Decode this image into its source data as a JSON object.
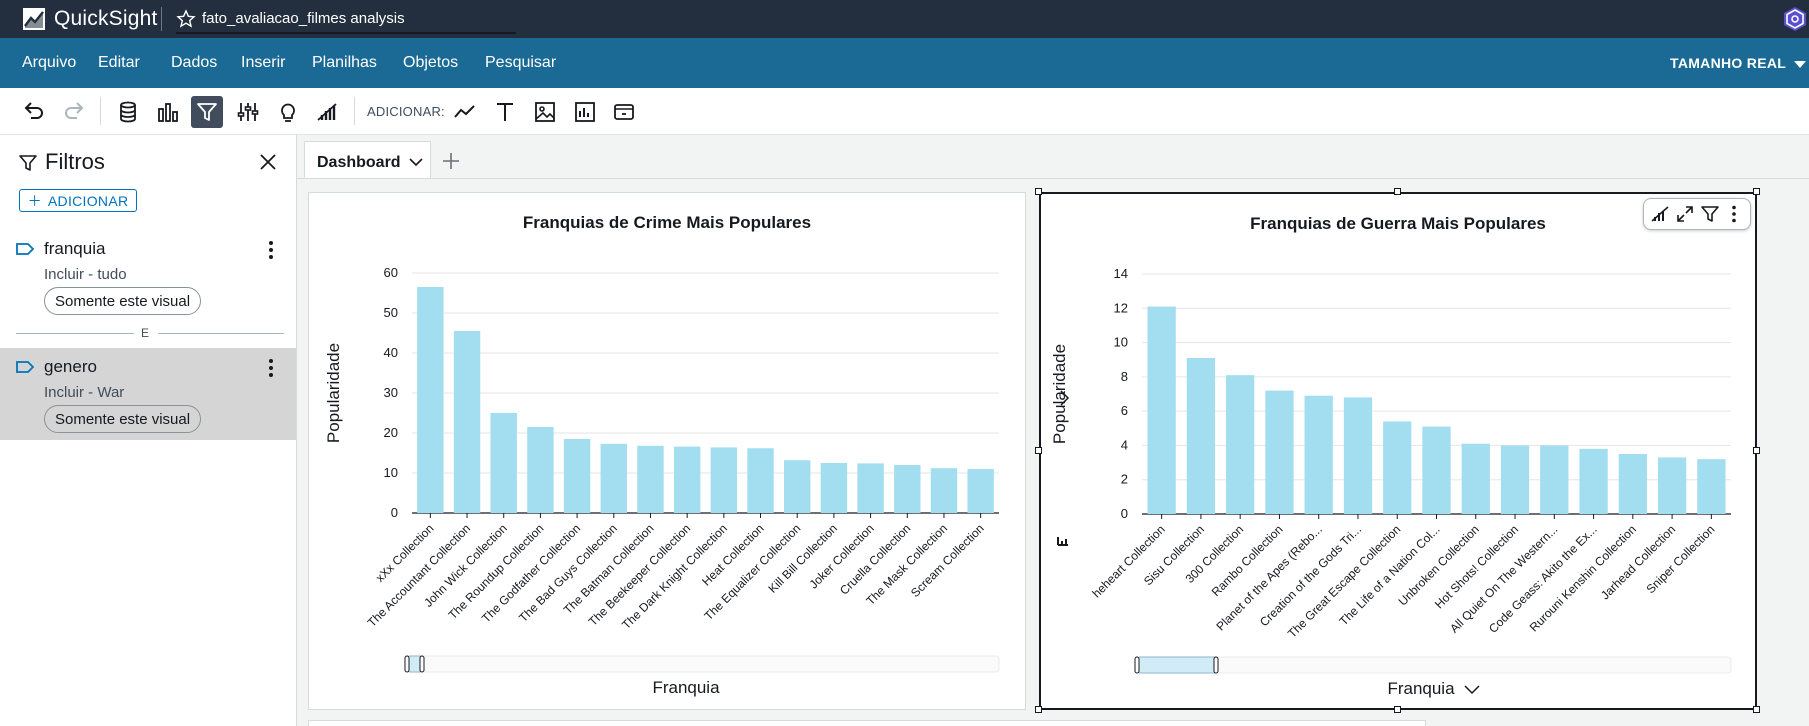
{
  "app": {
    "name": "QuickSight",
    "analysis_title": "fato_avaliacao_filmes analysis"
  },
  "menu": {
    "items": [
      "Arquivo",
      "Editar",
      "Dados",
      "Inserir",
      "Planilhas",
      "Objetos",
      "Pesquisar"
    ],
    "view_size": "TAMANHO REAL"
  },
  "toolbar": {
    "add_label": "ADICIONAR:",
    "icons": [
      "undo-icon",
      "redo-icon",
      "dataset-icon",
      "visualize-icon",
      "filter-icon",
      "parameters-icon",
      "insights-icon",
      "forecast-icon",
      "add-line-chart-icon",
      "add-text-icon",
      "add-image-icon",
      "add-insight-icon",
      "add-embed-icon"
    ]
  },
  "filters": {
    "title": "Filtros",
    "add_button": "ADICIONAR",
    "and_label": "E",
    "items": [
      {
        "field": "franquia",
        "condition": "Incluir - tudo",
        "scope": "Somente este visual",
        "selected": false
      },
      {
        "field": "genero",
        "condition": "Incluir - War",
        "scope": "Somente este visual",
        "selected": true
      }
    ]
  },
  "sheet": {
    "tab_label": "Dashboard"
  },
  "colors": {
    "bar": "#a3ddf0",
    "menubar": "#1a6a95",
    "topbar": "#232f3e",
    "accent": "#0073bb"
  },
  "chart_data": [
    {
      "type": "bar",
      "title": "Franquias de Crime Mais Populares",
      "xlabel": "Franquia",
      "ylabel": "Popularidade",
      "ylim": [
        0,
        60
      ],
      "yticks": [
        0,
        10,
        20,
        30,
        40,
        50,
        60
      ],
      "grid": true,
      "categories": [
        "xXx Collection",
        "The Accountant Collection",
        "John Wick Collection",
        "The Roundup Collection",
        "The Godfather Collection",
        "The Bad Guys Collection",
        "The Batman Collection",
        "The Beekeeper Collection",
        "The Dark Knight Collection",
        "Heat Collection",
        "The Equalizer Collection",
        "Kill Bill Collection",
        "Joker Collection",
        "Cruella Collection",
        "The Mask Collection",
        "Scream Collection"
      ],
      "values": [
        56.5,
        45.5,
        25,
        21.5,
        18.5,
        17.3,
        16.8,
        16.6,
        16.4,
        16.2,
        13.2,
        12.5,
        12.4,
        12,
        11.2,
        11
      ]
    },
    {
      "type": "bar",
      "title": "Franquias de Guerra Mais Populares",
      "xlabel": "Franquia",
      "ylabel": "Popularidade",
      "ylim": [
        0,
        14
      ],
      "yticks": [
        0,
        2,
        4,
        6,
        8,
        10,
        12,
        14
      ],
      "grid": true,
      "categories": [
        "heheart Collection",
        "Sisu Collection",
        "300 Collection",
        "Rambo Collection",
        "Planet of the Apes (Rebo...",
        "Creation of the Gods Tri...",
        "The Great Escape Collection",
        "The Life of a Nation Col...",
        "Unbroken Collection",
        "Hot Shots! Collection",
        "All Quiet On The Western...",
        "Code Geass: Akito the Ex...",
        "Rurouni Kenshin Collection",
        "Jarhead Collection",
        "Sniper Collection"
      ],
      "values": [
        12.1,
        9.1,
        8.1,
        7.2,
        6.9,
        6.8,
        5.4,
        5.1,
        4.1,
        4.0,
        4.0,
        3.8,
        3.5,
        3.3,
        3.2
      ]
    }
  ]
}
